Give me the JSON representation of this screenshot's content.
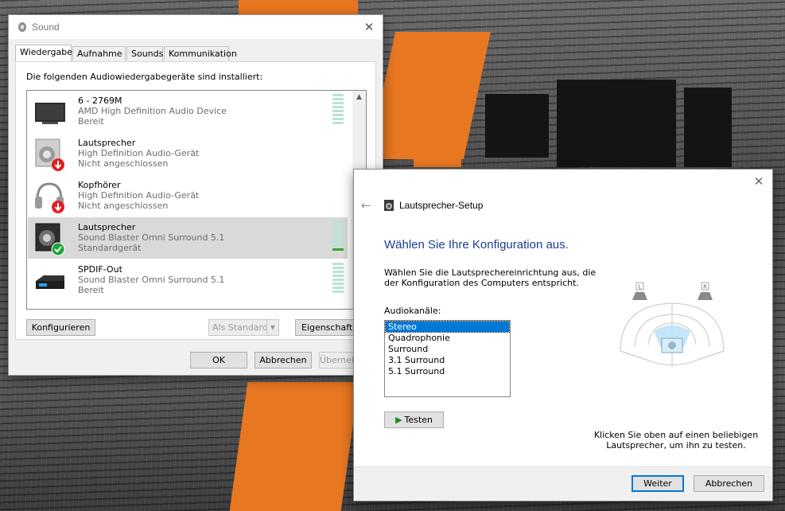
{
  "sound_window": {
    "title": "Sound",
    "close_glyph": "✕",
    "tabs": [
      {
        "label": "Wiedergabe"
      },
      {
        "label": "Aufnahme"
      },
      {
        "label": "Sounds"
      },
      {
        "label": "Kommunikation"
      }
    ],
    "heading": "Die folgenden Audiowiedergabegeräte sind installiert:",
    "devices": [
      {
        "name": "6 - 2769M",
        "description": "AMD High Definition Audio Device",
        "status": "Bereit",
        "icon": "monitor-icon"
      },
      {
        "name": "Lautsprecher",
        "description": "High Definition Audio-Gerät",
        "status": "Nicht angeschlossen",
        "icon": "speaker-icon"
      },
      {
        "name": "Kopfhörer",
        "description": "High Definition Audio-Gerät",
        "status": "Nicht angeschlossen",
        "icon": "headphones-icon"
      },
      {
        "name": "Lautsprecher",
        "description": "Sound Blaster Omni Surround 5.1",
        "status": "Standardgerät",
        "icon": "speaker-icon"
      },
      {
        "name": "SPDIF-Out",
        "description": "Sound Blaster Omni Surround 5.1",
        "status": "Bereit",
        "icon": "spdif-icon"
      }
    ],
    "buttons": {
      "configure": "Konfigurieren",
      "set_default": "Als Standard",
      "properties": "Eigenschaften",
      "ok": "OK",
      "cancel": "Abbrechen",
      "apply": "Übernehmen"
    },
    "scroll_up_glyph": "▲"
  },
  "setup_window": {
    "title": "Lautsprecher-Setup",
    "close_glyph": "✕",
    "back_glyph": "←",
    "heading": "Wählen Sie Ihre Konfiguration aus.",
    "description": "Wählen Sie die Lautsprechereinrichtung aus, die der Konfiguration des Computers entspricht.",
    "channels_label": "Audiokanäle:",
    "channels": [
      "Stereo",
      "Quadrophonie",
      "Surround",
      "3.1 Surround",
      "5.1 Surround"
    ],
    "selected_channel": "Stereo",
    "test_label": "Testen",
    "speaker_labels": {
      "left": "L",
      "right": "R"
    },
    "hint": "Klicken Sie oben auf einen beliebigen Lautsprecher, um ihn zu testen.",
    "next_label": "Weiter",
    "cancel_label": "Abbrechen"
  },
  "colors": {
    "accent": "#0078d7",
    "heading_blue": "#1e3d8f",
    "meter_green": "#2eaa2e",
    "status_check": "#1fa33a",
    "disconnected_red": "#e0201f"
  }
}
